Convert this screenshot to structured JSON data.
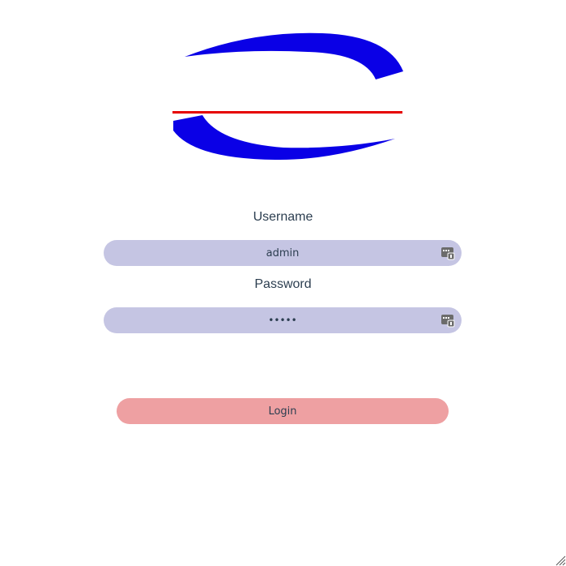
{
  "login_form": {
    "username_label": "Username",
    "username_value": "admin",
    "password_label": "Password",
    "password_value": "admin",
    "login_label": "Login"
  },
  "icons": {
    "logo": "brand-logo-icon",
    "password_manager": "password-manager-key-icon",
    "resize": "resize-grip-icon"
  },
  "colors": {
    "logo_blue": "#0a00e6",
    "logo_red": "#e60000",
    "input_background": "#c5c5e3",
    "button_background": "#eea0a2",
    "text": "#2c3e50"
  }
}
